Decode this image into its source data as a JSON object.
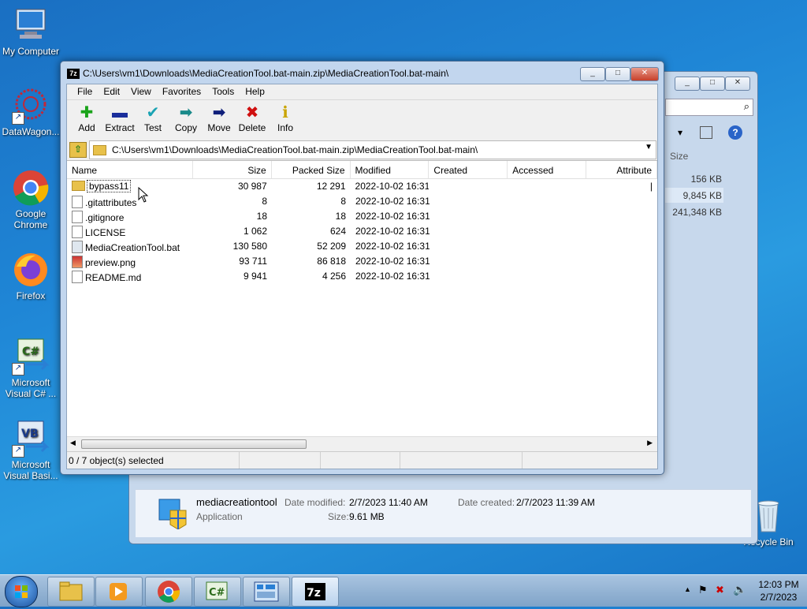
{
  "desktop": {
    "icons": [
      {
        "label": "My Computer"
      },
      {
        "label": "DataWagon..."
      },
      {
        "label": "Google Chrome"
      },
      {
        "label": "Firefox"
      },
      {
        "label": "Microsoft Visual C# ..."
      },
      {
        "label": "Microsoft Visual Basi..."
      },
      {
        "label": "Recycle Bin"
      }
    ]
  },
  "explorer": {
    "sizes_header": "Size",
    "sizes": [
      "156 KB",
      "9,845 KB",
      "241,348 KB"
    ],
    "details": {
      "name": "mediacreationtool",
      "type": "Application",
      "modified_label": "Date modified:",
      "modified_value": "2/7/2023 11:40 AM",
      "created_label": "Date created:",
      "created_value": "2/7/2023 11:39 AM",
      "size_label": "Size:",
      "size_value": "9.61 MB"
    }
  },
  "zip": {
    "title": "C:\\Users\\vm1\\Downloads\\MediaCreationTool.bat-main.zip\\MediaCreationTool.bat-main\\",
    "logo": "7z",
    "menu": [
      "File",
      "Edit",
      "View",
      "Favorites",
      "Tools",
      "Help"
    ],
    "toolbar": [
      {
        "label": "Add",
        "glyph": "✚",
        "color": "#1aa31a"
      },
      {
        "label": "Extract",
        "glyph": "▬",
        "color": "#1b2f9c"
      },
      {
        "label": "Test",
        "glyph": "✔",
        "color": "#1aa3b3"
      },
      {
        "label": "Copy",
        "glyph": "➡",
        "color": "#1a8a8a"
      },
      {
        "label": "Move",
        "glyph": "➡",
        "color": "#0f1f7a"
      },
      {
        "label": "Delete",
        "glyph": "✖",
        "color": "#d01010"
      },
      {
        "label": "Info",
        "glyph": "ℹ",
        "color": "#c9a400"
      }
    ],
    "address": "C:\\Users\\vm1\\Downloads\\MediaCreationTool.bat-main.zip\\MediaCreationTool.bat-main\\",
    "columns": [
      "Name",
      "Size",
      "Packed Size",
      "Modified",
      "Created",
      "Accessed",
      "Attribute"
    ],
    "rows": [
      {
        "name": "bypass11",
        "size": "30 987",
        "packed": "12 291",
        "modified": "2022-10-02 16:31",
        "folder": true
      },
      {
        "name": ".gitattributes",
        "size": "8",
        "packed": "8",
        "modified": "2022-10-02 16:31"
      },
      {
        "name": ".gitignore",
        "size": "18",
        "packed": "18",
        "modified": "2022-10-02 16:31"
      },
      {
        "name": "LICENSE",
        "size": "1 062",
        "packed": "624",
        "modified": "2022-10-02 16:31"
      },
      {
        "name": "MediaCreationTool.bat",
        "size": "130 580",
        "packed": "52 209",
        "modified": "2022-10-02 16:31"
      },
      {
        "name": "preview.png",
        "size": "93 711",
        "packed": "86 818",
        "modified": "2022-10-02 16:31"
      },
      {
        "name": "README.md",
        "size": "9 941",
        "packed": "4 256",
        "modified": "2022-10-02 16:31"
      }
    ],
    "status": "0 / 7 object(s) selected"
  },
  "taskbar": {
    "time": "12:03 PM",
    "date": "2/7/2023"
  }
}
